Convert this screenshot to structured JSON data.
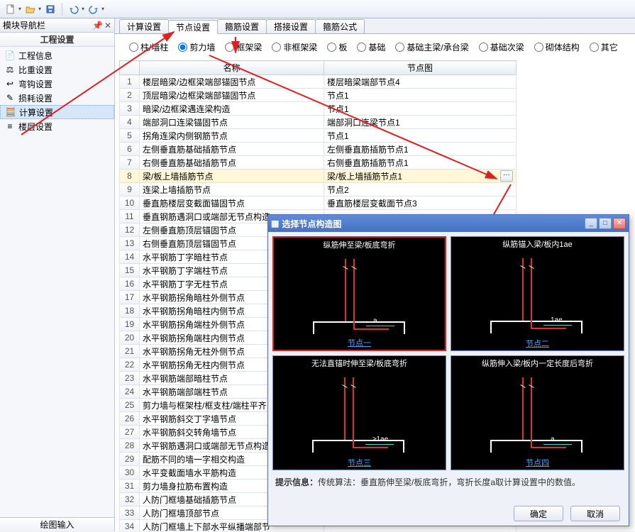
{
  "toolbar": {
    "icons": [
      "new-doc",
      "open",
      "save",
      "undo",
      "redo"
    ]
  },
  "nav": {
    "title": "模块导航栏",
    "section": "工程设置",
    "items": [
      {
        "label": "工程信息",
        "icon": "info"
      },
      {
        "label": "比重设置",
        "icon": "weight"
      },
      {
        "label": "弯钩设置",
        "icon": "hook"
      },
      {
        "label": "损耗设置",
        "icon": "loss"
      },
      {
        "label": "计算设置",
        "icon": "calc",
        "selected": true
      },
      {
        "label": "楼层设置",
        "icon": "floor"
      }
    ],
    "bottom": "绘图输入"
  },
  "tabs": [
    "计算设置",
    "节点设置",
    "箍筋设置",
    "搭接设置",
    "箍筋公式"
  ],
  "active_tab": 1,
  "radios": [
    "柱/墙柱",
    "剪力墙",
    "框架梁",
    "非框架梁",
    "板",
    "基础",
    "基础主梁/承台梁",
    "基础次梁",
    "砌体结构",
    "其它"
  ],
  "radio_selected": 1,
  "grid": {
    "headers": [
      "",
      "名称",
      "节点图"
    ],
    "rows": [
      {
        "n": 1,
        "name": "楼层暗梁/边框梁端部锚固节点",
        "val": "楼层暗梁端部节点4"
      },
      {
        "n": 2,
        "name": "顶层暗梁/边框梁端部锚固节点",
        "val": "节点1"
      },
      {
        "n": 3,
        "name": "暗梁/边框梁遇连梁构造",
        "val": "节点1"
      },
      {
        "n": 4,
        "name": "端部洞口连梁锚固节点",
        "val": "端部洞口连梁节点1"
      },
      {
        "n": 5,
        "name": "拐角连梁内侧钢筋节点",
        "val": "节点1"
      },
      {
        "n": 6,
        "name": "左侧垂直筋基础插筋节点",
        "val": "左侧垂直筋插筋节点1"
      },
      {
        "n": 7,
        "name": "右侧垂直筋基础插筋节点",
        "val": "右侧垂直筋插筋节点1"
      },
      {
        "n": 8,
        "name": "梁/板上墙插筋节点",
        "val": "梁/板上墙插筋节点1",
        "selected": true,
        "btn": true
      },
      {
        "n": 9,
        "name": "连梁上墙插筋节点",
        "val": "节点2"
      },
      {
        "n": 10,
        "name": "垂直筋楼层变截面锚固节点",
        "val": "垂直筋楼层变截面节点3"
      },
      {
        "n": 11,
        "name": "垂直钢筋遇洞口或端部无节点构造"
      },
      {
        "n": 12,
        "name": "左侧垂直筋顶层锚固节点"
      },
      {
        "n": 13,
        "name": "右侧垂直筋顶层锚固节点"
      },
      {
        "n": 14,
        "name": "水平钢筋丁字暗柱节点"
      },
      {
        "n": 15,
        "name": "水平钢筋丁字端柱节点"
      },
      {
        "n": 16,
        "name": "水平钢筋丁字无柱节点"
      },
      {
        "n": 17,
        "name": "水平钢筋拐角暗柱外侧节点"
      },
      {
        "n": 18,
        "name": "水平钢筋拐角暗柱内侧节点"
      },
      {
        "n": 19,
        "name": "水平钢筋拐角端柱外侧节点"
      },
      {
        "n": 20,
        "name": "水平钢筋拐角端柱内侧节点"
      },
      {
        "n": 21,
        "name": "水平钢筋拐角无柱外侧节点"
      },
      {
        "n": 22,
        "name": "水平钢筋拐角无柱内侧节点"
      },
      {
        "n": 23,
        "name": "水平钢筋端部暗柱节点"
      },
      {
        "n": 24,
        "name": "水平钢筋端部端柱节点"
      },
      {
        "n": 25,
        "name": "剪力墙与框架柱/框支柱/端柱平齐"
      },
      {
        "n": 26,
        "name": "水平钢筋斜交丁字墙节点"
      },
      {
        "n": 27,
        "name": "水平钢筋斜交转角墙节点"
      },
      {
        "n": 28,
        "name": "水平钢筋遇洞口或端部无节点构造"
      },
      {
        "n": 29,
        "name": "配筋不同的墙一字相交构造"
      },
      {
        "n": 30,
        "name": "水平变截面墙水平筋构造"
      },
      {
        "n": 31,
        "name": "剪力墙身拉筋布置构造"
      },
      {
        "n": 32,
        "name": "人防门框墙基础插筋节点"
      },
      {
        "n": 33,
        "name": "人防门框墙顶部节点"
      },
      {
        "n": 34,
        "name": "人防门框墙上下部水平纵播端部节"
      }
    ]
  },
  "dialog": {
    "title": "选择节点构造图",
    "thumbs": [
      {
        "title": "纵筋伸至梁/板底弯折",
        "link": "节点一",
        "selected": true,
        "a": "a"
      },
      {
        "title": "纵筋锚入梁/板内1ae",
        "link": "节点二",
        "a": "1ae"
      },
      {
        "title": "无法直锚时伸至梁/板底弯折",
        "link": "节点三",
        "a": "≥1ae"
      },
      {
        "title": "纵筋伸入梁/板内一定长度后弯折",
        "link": "节点四",
        "a": "a"
      }
    ],
    "hint_label": "提示信息：",
    "hint": "传统算法：垂直筋伸至梁/板底弯折，弯折长度a取计算设置中的数值。",
    "ok": "确定",
    "cancel": "取消"
  }
}
